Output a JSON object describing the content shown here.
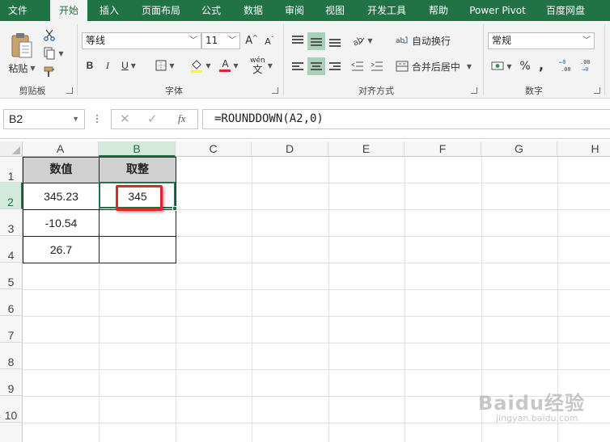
{
  "tabs": [
    "文件",
    "开始",
    "插入",
    "页面布局",
    "公式",
    "数据",
    "审阅",
    "视图",
    "开发工具",
    "帮助",
    "Power Pivot",
    "百度网盘"
  ],
  "ribbon": {
    "clipboard": {
      "paste_label": "粘贴",
      "group_label": "剪贴板"
    },
    "font": {
      "font_name": "等线",
      "font_size": "11",
      "bold": "B",
      "italic": "I",
      "underline": "U",
      "font_color_glyph": "A",
      "phonetic_glyph": "wén",
      "phonetic_char": "文",
      "grow": "A",
      "shrink": "A",
      "group_label": "字体"
    },
    "alignment": {
      "wrap_label": "自动换行",
      "merge_label": "合并后居中",
      "group_label": "对齐方式"
    },
    "number": {
      "format": "常规",
      "percent": "%",
      "comma": ",",
      "group_label": "数字"
    }
  },
  "formula_bar": {
    "name_box": "B2",
    "fx": "fx",
    "formula": "=ROUNDDOWN(A2,0)"
  },
  "grid": {
    "columns": [
      "A",
      "B",
      "C",
      "D",
      "E",
      "F",
      "G",
      "H"
    ],
    "rows": [
      "1",
      "2",
      "3",
      "4",
      "5",
      "6",
      "7",
      "8",
      "9",
      "10"
    ],
    "cells": {
      "A1": "数值",
      "B1": "取整",
      "A2": "345.23",
      "B2": "345",
      "A3": "-10.54",
      "A4": "26.7"
    }
  },
  "watermark": {
    "logo": "Baidu经验",
    "url": "jingyan.baidu.com"
  },
  "colors": {
    "accent": "#217346",
    "selection_fill": "#d3e9db",
    "header_fill": "#d0d0d0",
    "highlight": "#e0252c"
  }
}
